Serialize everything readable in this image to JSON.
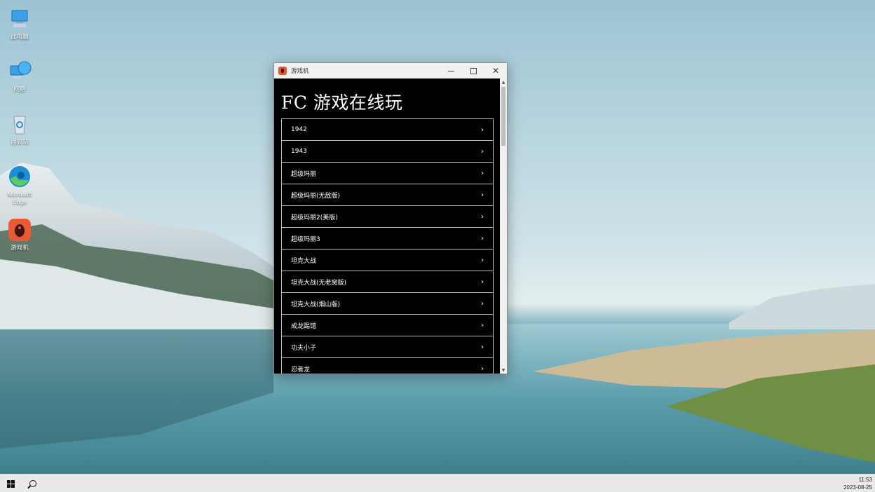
{
  "desktop": {
    "icons": [
      {
        "label": "此电脑",
        "icon": "computer-icon"
      },
      {
        "label": "网络",
        "icon": "network-icon"
      },
      {
        "label": "回收站",
        "icon": "recycle-bin-icon"
      },
      {
        "label": "Microsoft Edge",
        "icon": "edge-icon"
      },
      {
        "label": "游戏机",
        "icon": "game-console-icon"
      }
    ]
  },
  "window": {
    "title": "游戏机",
    "controls": {
      "minimize": "minimize-icon",
      "maximize": "maximize-icon",
      "close": "✕"
    },
    "page_title": "FC 游戏在线玩",
    "games": [
      "1942",
      "1943",
      "超级玛丽",
      "超级玛丽(无敌版)",
      "超级玛丽2(美版)",
      "超级玛丽3",
      "坦克大战",
      "坦克大战(无老窝版)",
      "坦克大战(烟山版)",
      "成龙踢馆",
      "功夫小子",
      "忍者龙"
    ],
    "chevron": "›",
    "scroll": {
      "up": "▲",
      "down": "▼"
    }
  },
  "taskbar": {
    "time": "11:53",
    "date": "2023-08-25"
  },
  "colors": {
    "window_bg": "#000000",
    "item_border": "#bdbdbd",
    "app_icon": "#e5552f",
    "taskbar_bg": "#e9e9e9"
  }
}
